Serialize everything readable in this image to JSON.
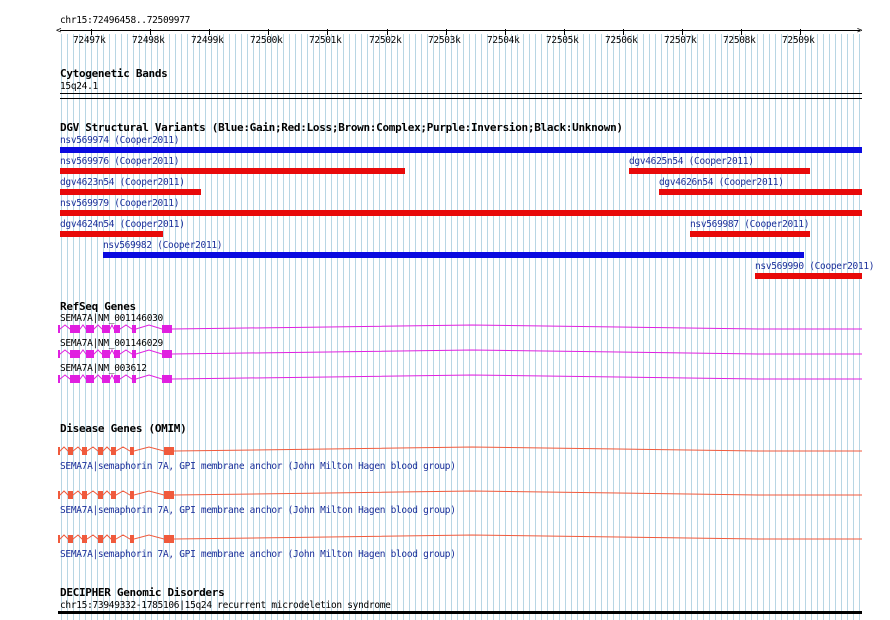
{
  "region": "chr15:72496458..72509977",
  "ruler": {
    "ticks": [
      "72497k",
      "72498k",
      "72499k",
      "72500k",
      "72501k",
      "72502k",
      "72503k",
      "72504k",
      "72505k",
      "72506k",
      "72507k",
      "72508k",
      "72509k"
    ]
  },
  "tracks": {
    "cytoband": {
      "title": "Cytogenetic Bands",
      "band": "15q24.1"
    },
    "dgv": {
      "title": "DGV Structural Variants (Blue:Gain;Red:Loss;Brown:Complex;Purple:Inversion;Black:Unknown)",
      "variants": [
        {
          "label": "nsv569974 (Cooper2011)",
          "color": "#0a0ae0"
        },
        {
          "label": "nsv569976 (Cooper2011)",
          "color": "#e80a0a"
        },
        {
          "label": "dgv4625n54 (Cooper2011)",
          "color": "#e80a0a"
        },
        {
          "label": "dgv4623n54 (Cooper2011)",
          "color": "#e80a0a"
        },
        {
          "label": "dgv4626n54 (Cooper2011)",
          "color": "#e80a0a"
        },
        {
          "label": "nsv569979 (Cooper2011)",
          "color": "#e80a0a"
        },
        {
          "label": "dgv4624n54 (Cooper2011)",
          "color": "#e80a0a"
        },
        {
          "label": "nsv569987 (Cooper2011)",
          "color": "#e80a0a"
        },
        {
          "label": "nsv569982 (Cooper2011)",
          "color": "#0a0ae0"
        },
        {
          "label": "nsv569990 (Cooper2011)",
          "color": "#e80a0a"
        }
      ]
    },
    "refseq": {
      "title": "RefSeq Genes",
      "color": "#e020e0",
      "genes": [
        {
          "label": "SEMA7A|NM_001146030"
        },
        {
          "label": "SEMA7A|NM_001146029"
        },
        {
          "label": "SEMA7A|NM_003612"
        }
      ]
    },
    "omim": {
      "title": "Disease Genes (OMIM)",
      "color": "#f05a3c",
      "genes": [
        {
          "label": "SEMA7A|semaphorin 7A, GPI membrane anchor (John Milton Hagen blood group)"
        },
        {
          "label": "SEMA7A|semaphorin 7A, GPI membrane anchor (John Milton Hagen blood group)"
        },
        {
          "label": "SEMA7A|semaphorin 7A, GPI membrane anchor (John Milton Hagen blood group)"
        }
      ]
    },
    "decipher": {
      "title": "DECIPHER Genomic Disorders",
      "entry": "chr15:73949332-1785106|15q24 recurrent microdeletion syndrome"
    }
  }
}
